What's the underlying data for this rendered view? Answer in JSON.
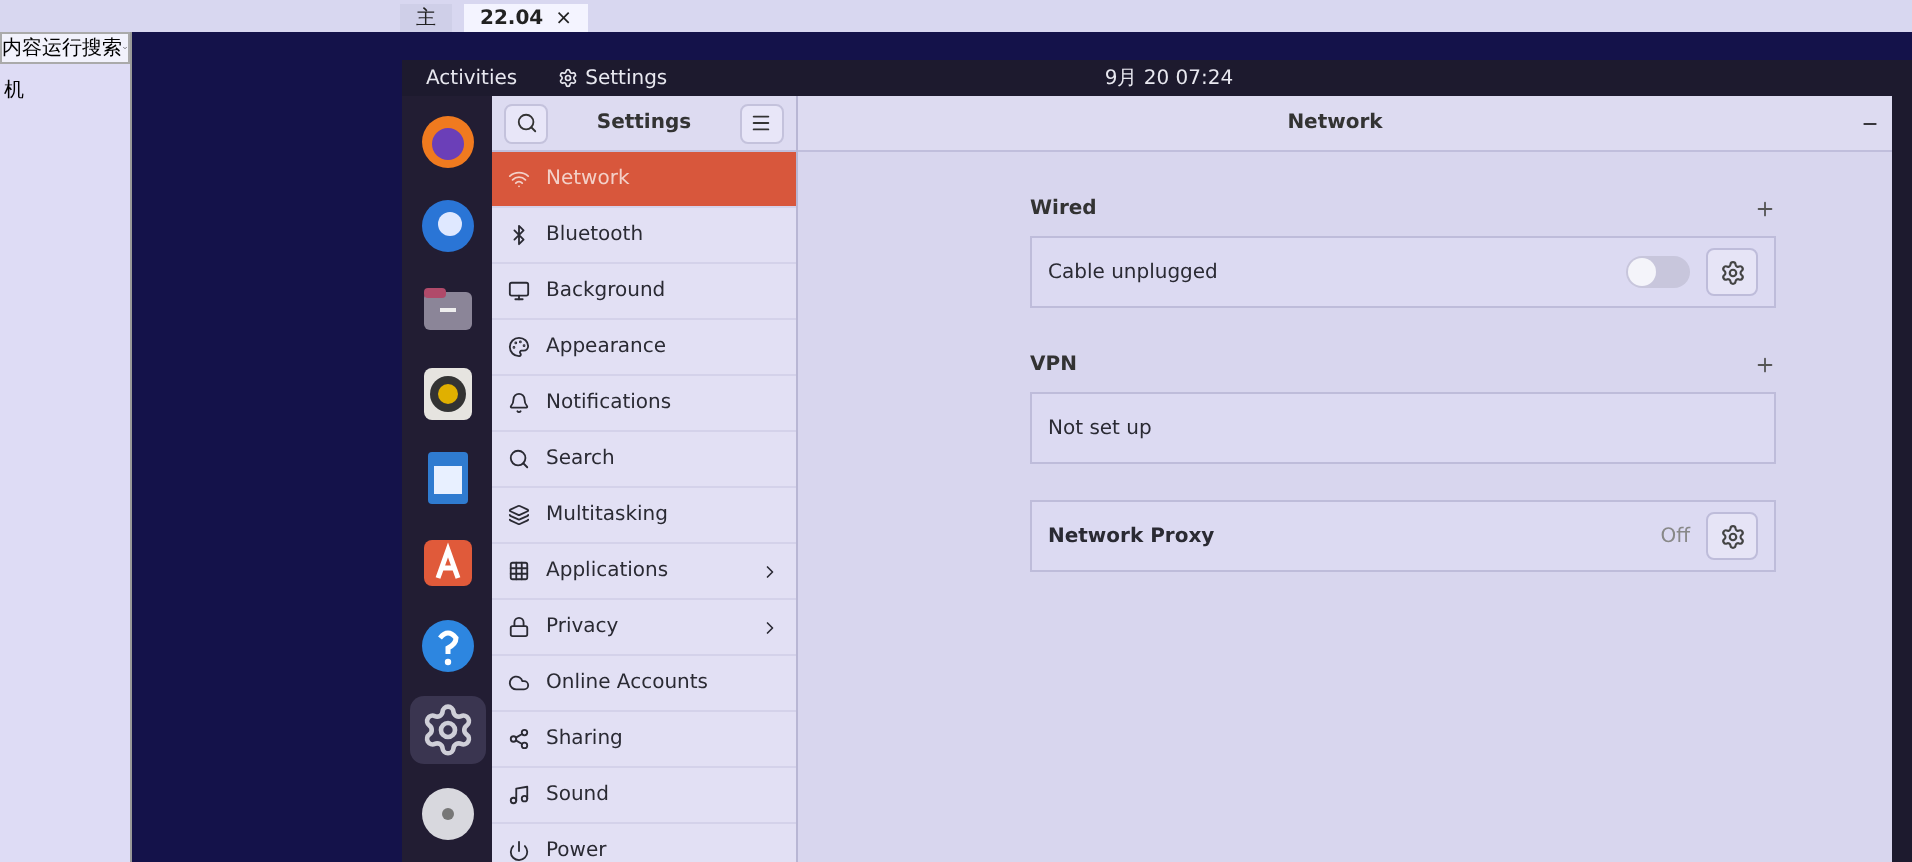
{
  "host_tabs": [
    {
      "label": "主",
      "selected": false
    },
    {
      "label": "22.04",
      "selected": true,
      "close": "×"
    }
  ],
  "host_sidebar": {
    "search": {
      "value": "内容运行搜索"
    },
    "items": [
      "机"
    ]
  },
  "top_bar": {
    "activities": "Activities",
    "app_name": "Settings",
    "clock": "9月 20 07:24"
  },
  "dock": [
    {
      "selected": false
    },
    {
      "selected": false
    },
    {
      "selected": false
    },
    {
      "selected": false
    },
    {
      "selected": false
    },
    {
      "selected": false
    },
    {
      "selected": false
    },
    {
      "selected": true
    },
    {
      "selected": false
    }
  ],
  "sidebar": {
    "title": "Settings",
    "items": [
      {
        "label": "Network",
        "selected": true,
        "arrow": false
      },
      {
        "label": "Bluetooth",
        "selected": false,
        "arrow": false
      },
      {
        "label": "Background",
        "selected": false,
        "arrow": false
      },
      {
        "label": "Appearance",
        "selected": false,
        "arrow": false
      },
      {
        "label": "Notifications",
        "selected": false,
        "arrow": false
      },
      {
        "label": "Search",
        "selected": false,
        "arrow": false
      },
      {
        "label": "Multitasking",
        "selected": false,
        "arrow": false
      },
      {
        "label": "Applications",
        "selected": false,
        "arrow": true
      },
      {
        "label": "Privacy",
        "selected": false,
        "arrow": true
      },
      {
        "label": "Online Accounts",
        "selected": false,
        "arrow": false
      },
      {
        "label": "Sharing",
        "selected": false,
        "arrow": false
      },
      {
        "label": "Sound",
        "selected": false,
        "arrow": false
      },
      {
        "label": "Power",
        "selected": false,
        "arrow": false
      }
    ]
  },
  "content": {
    "title": "Network",
    "sections": [
      {
        "heading": "Wired",
        "addable": true,
        "rows": [
          {
            "kind": "toggle",
            "label": "Cable unplugged",
            "on": false
          }
        ]
      },
      {
        "heading": "VPN",
        "addable": true,
        "rows": [
          {
            "kind": "plain",
            "label": "Not set up"
          }
        ]
      },
      {
        "rows": [
          {
            "kind": "status",
            "label": "Network Proxy",
            "status": "Off"
          }
        ]
      }
    ]
  }
}
